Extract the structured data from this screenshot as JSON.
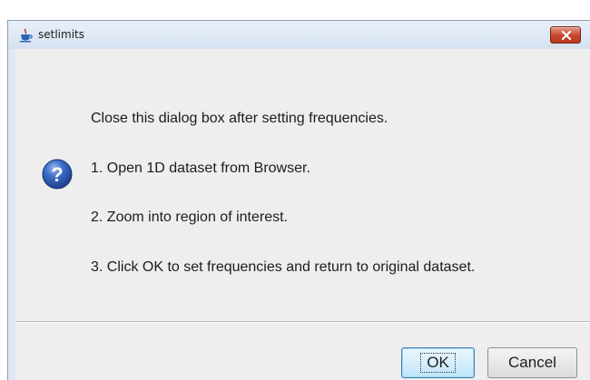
{
  "window": {
    "title": "setlimits",
    "app_icon": "java-cup-icon",
    "close_icon": "close-x-icon"
  },
  "dialog": {
    "icon": "question-icon",
    "messages": [
      "Close this dialog box after setting frequencies.",
      "1. Open 1D dataset from Browser.",
      "2. Zoom into region of interest.",
      "3. Click OK to set frequencies and return to original dataset."
    ]
  },
  "buttons": {
    "ok_label": "OK",
    "cancel_label": "Cancel"
  },
  "colors": {
    "client_background": "#eeeeee",
    "titlebar": "#dfe8f3",
    "close_button": "#c6452d",
    "question_icon": "#2f5fb4"
  }
}
